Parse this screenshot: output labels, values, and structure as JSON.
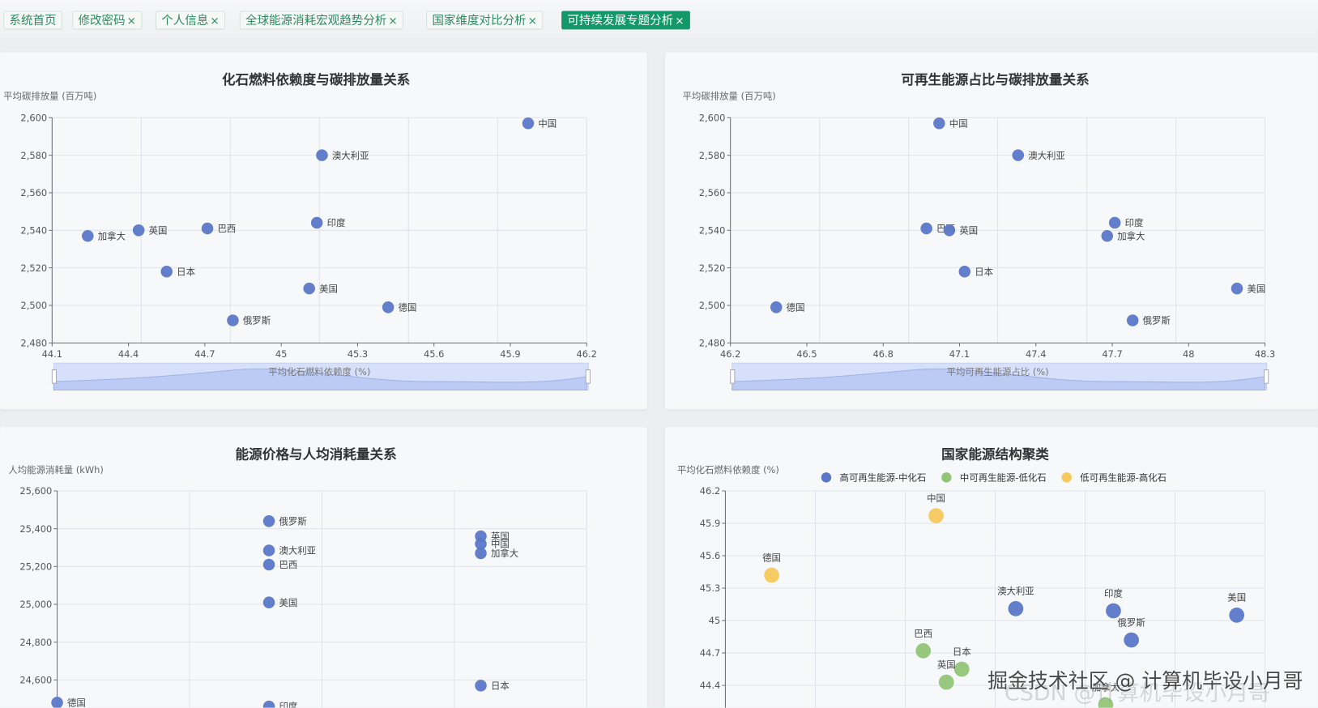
{
  "tabs": [
    {
      "label": "系统首页",
      "closable": false,
      "active": false
    },
    {
      "label": "修改密码",
      "closable": true,
      "active": false
    },
    {
      "label": "个人信息",
      "closable": true,
      "active": false
    },
    {
      "label": "全球能源消耗宏观趋势分析",
      "closable": true,
      "active": false
    },
    {
      "label": "国家维度对比分析",
      "closable": true,
      "active": false
    },
    {
      "label": "可持续发展专题分析",
      "closable": true,
      "active": true
    }
  ],
  "close_glyph": "×",
  "colors": {
    "blue": "#5b78c8",
    "green": "#91c576",
    "yellow": "#f7c85c",
    "active_tab": "#13986a"
  },
  "watermark": {
    "primary": "掘金技术社区 @ 计算机毕设小月哥",
    "secondary": "CSDN @计算机毕设小月哥"
  },
  "chart_data": [
    {
      "type": "scatter",
      "title": "化石燃料依赖度与碳排放量关系",
      "xlabel": "平均化石燃料依赖度 (%)",
      "ylabel": "平均碳排放量 (百万吨)",
      "xlim": [
        44.1,
        46.2
      ],
      "ylim": [
        2480,
        2600
      ],
      "xticks": [
        44.1,
        44.4,
        44.7,
        45,
        45.3,
        45.6,
        45.9,
        46.2
      ],
      "yticks": [
        2480,
        2500,
        2520,
        2540,
        2560,
        2580,
        2600
      ],
      "grid": true,
      "datazoom": true,
      "points": [
        {
          "name": "中国",
          "x": 45.97,
          "y": 2597
        },
        {
          "name": "澳大利亚",
          "x": 45.16,
          "y": 2580
        },
        {
          "name": "印度",
          "x": 45.14,
          "y": 2544
        },
        {
          "name": "巴西",
          "x": 44.71,
          "y": 2541
        },
        {
          "name": "英国",
          "x": 44.44,
          "y": 2540
        },
        {
          "name": "加拿大",
          "x": 44.24,
          "y": 2537
        },
        {
          "name": "日本",
          "x": 44.55,
          "y": 2518
        },
        {
          "name": "美国",
          "x": 45.11,
          "y": 2509
        },
        {
          "name": "德国",
          "x": 45.42,
          "y": 2499
        },
        {
          "name": "俄罗斯",
          "x": 44.81,
          "y": 2492
        }
      ]
    },
    {
      "type": "scatter",
      "title": "可再生能源占比与碳排放量关系",
      "xlabel": "平均可再生能源占比 (%)",
      "ylabel": "平均碳排放量 (百万吨)",
      "xlim": [
        46.2,
        48.3
      ],
      "ylim": [
        2480,
        2600
      ],
      "xticks": [
        46.2,
        46.5,
        46.8,
        47.1,
        47.4,
        47.7,
        48,
        48.3
      ],
      "yticks": [
        2480,
        2500,
        2520,
        2540,
        2560,
        2580,
        2600
      ],
      "grid": true,
      "datazoom": true,
      "points": [
        {
          "name": "中国",
          "x": 47.02,
          "y": 2597
        },
        {
          "name": "澳大利亚",
          "x": 47.33,
          "y": 2580
        },
        {
          "name": "巴西",
          "x": 46.97,
          "y": 2541
        },
        {
          "name": "英国",
          "x": 47.06,
          "y": 2540
        },
        {
          "name": "印度",
          "x": 47.71,
          "y": 2544
        },
        {
          "name": "加拿大",
          "x": 47.68,
          "y": 2537
        },
        {
          "name": "日本",
          "x": 47.12,
          "y": 2518
        },
        {
          "name": "德国",
          "x": 46.38,
          "y": 2499
        },
        {
          "name": "美国",
          "x": 48.19,
          "y": 2509
        },
        {
          "name": "俄罗斯",
          "x": 47.78,
          "y": 2492
        }
      ]
    },
    {
      "type": "scatter",
      "title": "能源价格与人均消耗量关系",
      "xlabel": "",
      "ylabel": "人均能源消耗量 (kWh)",
      "xlim": [
        0,
        5
      ],
      "ylim": [
        24400,
        25600
      ],
      "xticks": [],
      "yticks": [
        24600,
        24800,
        25000,
        25200,
        25400,
        25600
      ],
      "grid": true,
      "datazoom": false,
      "points": [
        {
          "name": "俄罗斯",
          "x": 2,
          "y": 25440
        },
        {
          "name": "澳大利亚",
          "x": 2,
          "y": 25285
        },
        {
          "name": "巴西",
          "x": 2,
          "y": 25210
        },
        {
          "name": "美国",
          "x": 2,
          "y": 25010
        },
        {
          "name": "印度",
          "x": 2,
          "y": 24460
        },
        {
          "name": "英国",
          "x": 4,
          "y": 25360
        },
        {
          "name": "中国",
          "x": 4,
          "y": 25320
        },
        {
          "name": "加拿大",
          "x": 4,
          "y": 25270
        },
        {
          "name": "日本",
          "x": 4,
          "y": 24570
        },
        {
          "name": "德国",
          "x": 0,
          "y": 24480
        }
      ]
    },
    {
      "type": "scatter",
      "title": "国家能源结构聚类",
      "xlabel": "",
      "ylabel": "平均化石燃料依赖度 (%)",
      "xlim": [
        46.2,
        48.3
      ],
      "ylim": [
        44.1,
        46.2
      ],
      "xticks": [],
      "yticks": [
        44.4,
        44.7,
        45,
        45.3,
        45.6,
        45.9,
        46.2
      ],
      "grid": true,
      "datazoom": false,
      "legend": [
        {
          "name": "高可再生能源-中化石",
          "color": "#5b78c8"
        },
        {
          "name": "中可再生能源-低化石",
          "color": "#91c576"
        },
        {
          "name": "低可再生能源-高化石",
          "color": "#f7c85c"
        }
      ],
      "points": [
        {
          "name": "中国",
          "x": 47.02,
          "y": 45.97,
          "cluster": 2
        },
        {
          "name": "德国",
          "x": 46.38,
          "y": 45.42,
          "cluster": 2
        },
        {
          "name": "澳大利亚",
          "x": 47.33,
          "y": 45.11,
          "cluster": 0
        },
        {
          "name": "印度",
          "x": 47.71,
          "y": 45.09,
          "cluster": 0
        },
        {
          "name": "美国",
          "x": 48.19,
          "y": 45.05,
          "cluster": 0
        },
        {
          "name": "俄罗斯",
          "x": 47.78,
          "y": 44.82,
          "cluster": 0
        },
        {
          "name": "巴西",
          "x": 46.97,
          "y": 44.72,
          "cluster": 1
        },
        {
          "name": "日本",
          "x": 47.12,
          "y": 44.55,
          "cluster": 1
        },
        {
          "name": "英国",
          "x": 47.06,
          "y": 44.43,
          "cluster": 1
        },
        {
          "name": "加拿大",
          "x": 47.68,
          "y": 44.22,
          "cluster": 1
        }
      ]
    }
  ]
}
